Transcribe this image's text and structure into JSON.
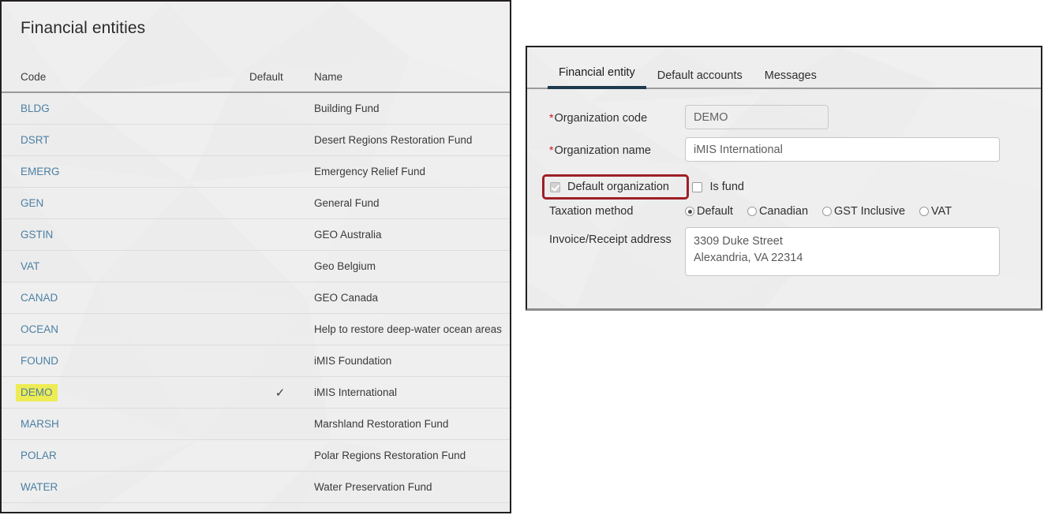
{
  "left_panel": {
    "title": "Financial entities",
    "columns": [
      "Code",
      "Default",
      "Name"
    ],
    "rows": [
      {
        "code": "BLDG",
        "default": "",
        "name": "Building Fund",
        "highlighted": false
      },
      {
        "code": "DSRT",
        "default": "",
        "name": "Desert Regions Restoration Fund",
        "highlighted": false
      },
      {
        "code": "EMERG",
        "default": "",
        "name": "Emergency Relief Fund",
        "highlighted": false
      },
      {
        "code": "GEN",
        "default": "",
        "name": "General Fund",
        "highlighted": false
      },
      {
        "code": "GSTIN",
        "default": "",
        "name": "GEO Australia",
        "highlighted": false
      },
      {
        "code": "VAT",
        "default": "",
        "name": "Geo Belgium",
        "highlighted": false
      },
      {
        "code": "CANAD",
        "default": "",
        "name": "GEO Canada",
        "highlighted": false
      },
      {
        "code": "OCEAN",
        "default": "",
        "name": "Help to restore deep-water ocean areas",
        "highlighted": false
      },
      {
        "code": "FOUND",
        "default": "",
        "name": "iMIS Foundation",
        "highlighted": false
      },
      {
        "code": "DEMO",
        "default": "✓",
        "name": "iMIS International",
        "highlighted": true
      },
      {
        "code": "MARSH",
        "default": "",
        "name": "Marshland Restoration Fund",
        "highlighted": false
      },
      {
        "code": "POLAR",
        "default": "",
        "name": "Polar Regions Restoration Fund",
        "highlighted": false
      },
      {
        "code": "WATER",
        "default": "",
        "name": "Water Preservation Fund",
        "highlighted": false
      }
    ]
  },
  "right_panel": {
    "tabs": [
      {
        "label": "Financial entity",
        "active": true
      },
      {
        "label": "Default accounts",
        "active": false
      },
      {
        "label": "Messages",
        "active": false
      }
    ],
    "fields": {
      "org_code_label": "Organization code",
      "org_code_value": "DEMO",
      "org_name_label": "Organization name",
      "org_name_value": "iMIS International",
      "default_org_label": "Default organization",
      "default_org_checked": true,
      "is_fund_label": "Is fund",
      "is_fund_checked": false,
      "taxation_label": "Taxation method",
      "taxation_options": [
        {
          "label": "Default",
          "selected": true
        },
        {
          "label": "Canadian",
          "selected": false
        },
        {
          "label": "GST Inclusive",
          "selected": false
        },
        {
          "label": "VAT",
          "selected": false
        }
      ],
      "address_label": "Invoice/Receipt address",
      "address_value": "3309 Duke Street\nAlexandria, VA 22314"
    },
    "required_marker": "*"
  },
  "colors": {
    "panel_background": "#ececec",
    "panel_border": "#231f20",
    "link": "#4b7fa2",
    "highlight_yellow": "#eeec54",
    "annotation_red": "#9d1f26",
    "required_red": "#c4161c",
    "active_tab_underline": "#1e3b4d"
  }
}
